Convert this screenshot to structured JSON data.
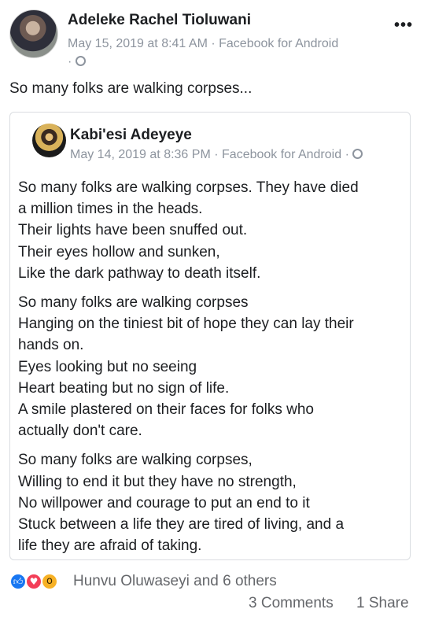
{
  "post": {
    "author": "Adeleke Rachel Tioluwani",
    "date": "May 15, 2019 at 8:41 AM",
    "source": "Facebook for Android",
    "separator": "·",
    "privacy_icon": "globe-icon",
    "more_label": "•••",
    "text": "So many folks are walking corpses..."
  },
  "shared_post": {
    "author": "Kabi'esi Adeyeye",
    "date": "May 14, 2019 at 8:36 PM",
    "source": "Facebook for Android",
    "separator": "·",
    "privacy_icon": "globe-icon",
    "paragraphs": [
      [
        "So many folks are walking corpses. They have died",
        "a million times in the heads.",
        "Their lights have been snuffed out.",
        "Their eyes hollow and sunken,",
        "Like the dark pathway to death itself."
      ],
      [
        "So many folks are walking corpses",
        "Hanging on the tiniest bit of hope they can lay their",
        "hands on.",
        "Eyes looking but no seeing",
        "Heart beating but no sign of life.",
        "A smile plastered on their faces for folks who",
        "actually don't care."
      ],
      [
        "So many folks are walking corpses,",
        "Willing to end it but they have no strength,",
        "No willpower and courage to put an end to it",
        "Stuck between a life they are tired of living, and a",
        "life they are afraid of taking."
      ]
    ]
  },
  "footer": {
    "reaction_icons": [
      "like-icon",
      "love-icon",
      "wow-icon"
    ],
    "reactions_text": "Hunvu Oluwaseyi and 6 others",
    "comments": "3 Comments",
    "shares": "1 Share"
  },
  "colors": {
    "like": "#1877f2",
    "love": "#f33e58",
    "wow": "#f7b125",
    "meta_gray": "#8d949e",
    "border": "#dadde1"
  }
}
